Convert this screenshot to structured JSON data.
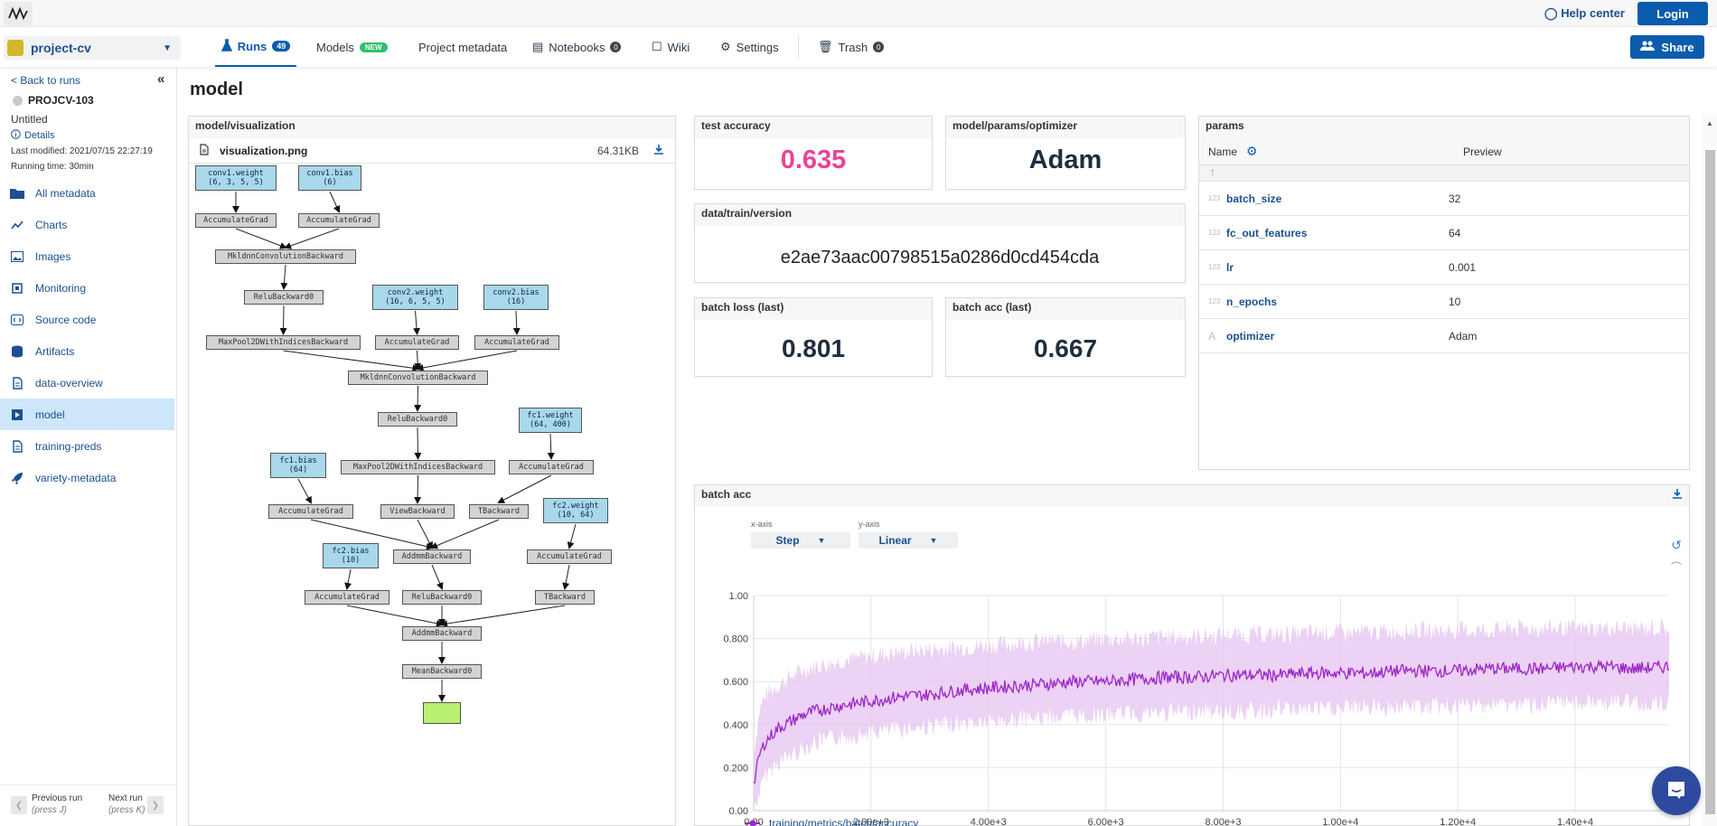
{
  "topbar": {
    "logo": "neptune-logo",
    "help_label": "Help center",
    "login_label": "Login"
  },
  "nav": {
    "project_name": "project-cv",
    "project_color": "#d4b62a",
    "tabs": [
      {
        "label": "Runs",
        "badge": "49",
        "active": true
      },
      {
        "label": "Models",
        "badge": "NEW"
      },
      {
        "label": "Project metadata"
      },
      {
        "label": "Notebooks",
        "badge": "0"
      },
      {
        "label": "Wiki"
      },
      {
        "label": "Settings"
      },
      {
        "label": "Trash",
        "badge": "0"
      }
    ],
    "share_label": "Share"
  },
  "sidebar": {
    "back_label": "< Back to runs",
    "collapse_label": "«",
    "run_id": "PROJCV-103",
    "run_name": "Untitled",
    "details_label": "Details",
    "last_modified": "Last modified: 2021/07/15 22:27:19",
    "running_time": "Running time: 30min",
    "items": [
      {
        "label": "All metadata",
        "icon": "folder-icon"
      },
      {
        "label": "Charts",
        "icon": "chart-icon"
      },
      {
        "label": "Images",
        "icon": "image-icon"
      },
      {
        "label": "Monitoring",
        "icon": "cpu-icon"
      },
      {
        "label": "Source code",
        "icon": "code-icon"
      },
      {
        "label": "Artifacts",
        "icon": "database-icon"
      },
      {
        "label": "data-overview",
        "icon": "document-icon"
      },
      {
        "label": "model",
        "icon": "play-icon",
        "active": true
      },
      {
        "label": "training-preds",
        "icon": "document-icon"
      },
      {
        "label": "variety-metadata",
        "icon": "rocket-icon"
      }
    ],
    "prev_label": "Previous run",
    "prev_hint": "(press J)",
    "next_label": "Next run",
    "next_hint": "(press K)"
  },
  "main": {
    "title": "model",
    "visualization": {
      "title": "model/visualization",
      "file_name": "visualization.png",
      "file_size": "64.31KB",
      "nodes": [
        {
          "id": "n1",
          "label": "conv1.weight\n(6, 3, 5, 5)",
          "kind": "param"
        },
        {
          "id": "n2",
          "label": "conv1.bias\n(6)",
          "kind": "param"
        },
        {
          "id": "n3",
          "label": "AccumulateGrad",
          "kind": "op"
        },
        {
          "id": "n4",
          "label": "AccumulateGrad",
          "kind": "op"
        },
        {
          "id": "n5",
          "label": "MkldnnConvolutionBackward",
          "kind": "op"
        },
        {
          "id": "n6",
          "label": "ReluBackward0",
          "kind": "op"
        },
        {
          "id": "n7",
          "label": "conv2.weight\n(16, 6, 5, 5)",
          "kind": "param"
        },
        {
          "id": "n8",
          "label": "conv2.bias\n(16)",
          "kind": "param"
        },
        {
          "id": "n9",
          "label": "MaxPool2DWithIndicesBackward",
          "kind": "op"
        },
        {
          "id": "n10",
          "label": "AccumulateGrad",
          "kind": "op"
        },
        {
          "id": "n11",
          "label": "AccumulateGrad",
          "kind": "op"
        },
        {
          "id": "n12",
          "label": "MkldnnConvolutionBackward",
          "kind": "op"
        },
        {
          "id": "n13",
          "label": "ReluBackward0",
          "kind": "op"
        },
        {
          "id": "n14",
          "label": "fc1.weight\n(64, 400)",
          "kind": "param"
        },
        {
          "id": "n15",
          "label": "fc1.bias\n(64)",
          "kind": "param"
        },
        {
          "id": "n16",
          "label": "MaxPool2DWithIndicesBackward",
          "kind": "op"
        },
        {
          "id": "n17",
          "label": "AccumulateGrad",
          "kind": "op"
        },
        {
          "id": "n18",
          "label": "AccumulateGrad",
          "kind": "op"
        },
        {
          "id": "n19",
          "label": "ViewBackward",
          "kind": "op"
        },
        {
          "id": "n20",
          "label": "TBackward",
          "kind": "op"
        },
        {
          "id": "n21",
          "label": "fc2.weight\n(10, 64)",
          "kind": "param"
        },
        {
          "id": "n22",
          "label": "fc2.bias\n(10)",
          "kind": "param"
        },
        {
          "id": "n23",
          "label": "AddmmBackward",
          "kind": "op"
        },
        {
          "id": "n24",
          "label": "AccumulateGrad",
          "kind": "op"
        },
        {
          "id": "n25",
          "label": "AccumulateGrad",
          "kind": "op"
        },
        {
          "id": "n26",
          "label": "ReluBackward0",
          "kind": "op"
        },
        {
          "id": "n27",
          "label": "TBackward",
          "kind": "op"
        },
        {
          "id": "n28",
          "label": "AddmmBackward",
          "kind": "op"
        },
        {
          "id": "n29",
          "label": "MeanBackward0",
          "kind": "op"
        },
        {
          "id": "n30",
          "label": "",
          "kind": "out"
        }
      ],
      "edges": [
        [
          "n1",
          "n3"
        ],
        [
          "n2",
          "n4"
        ],
        [
          "n3",
          "n5"
        ],
        [
          "n4",
          "n5"
        ],
        [
          "n5",
          "n6"
        ],
        [
          "n6",
          "n9"
        ],
        [
          "n7",
          "n10"
        ],
        [
          "n8",
          "n11"
        ],
        [
          "n9",
          "n12"
        ],
        [
          "n10",
          "n12"
        ],
        [
          "n11",
          "n12"
        ],
        [
          "n12",
          "n13"
        ],
        [
          "n13",
          "n16"
        ],
        [
          "n14",
          "n17"
        ],
        [
          "n15",
          "n18"
        ],
        [
          "n16",
          "n19"
        ],
        [
          "n17",
          "n20"
        ],
        [
          "n18",
          "n23"
        ],
        [
          "n19",
          "n23"
        ],
        [
          "n20",
          "n23"
        ],
        [
          "n21",
          "n25"
        ],
        [
          "n22",
          "n24"
        ],
        [
          "n23",
          "n26"
        ],
        [
          "n25",
          "n27"
        ],
        [
          "n24",
          "n28"
        ],
        [
          "n26",
          "n28"
        ],
        [
          "n27",
          "n28"
        ],
        [
          "n28",
          "n29"
        ],
        [
          "n29",
          "n30"
        ]
      ]
    },
    "tiles": {
      "test_accuracy": {
        "title": "test accuracy",
        "value": "0.635",
        "color": "#e8449a"
      },
      "optimizer": {
        "title": "model/params/optimizer",
        "value": "Adam"
      },
      "data_version": {
        "title": "data/train/version",
        "value": "e2ae73aac00798515a0286d0cd454cda"
      },
      "batch_loss": {
        "title": "batch loss (last)",
        "value": "0.801"
      },
      "batch_acc": {
        "title": "batch acc (last)",
        "value": "0.667"
      }
    },
    "params": {
      "title": "params",
      "col_name": "Name",
      "col_preview": "Preview",
      "up_label": "↑",
      "rows": [
        {
          "type": "123",
          "name": "batch_size",
          "value": "32"
        },
        {
          "type": "123",
          "name": "fc_out_features",
          "value": "64"
        },
        {
          "type": "123",
          "name": "lr",
          "value": "0.001"
        },
        {
          "type": "123",
          "name": "n_epochs",
          "value": "10"
        },
        {
          "type": "A",
          "name": "optimizer",
          "value": "Adam"
        }
      ]
    },
    "chart_panel": {
      "title": "batch acc",
      "xaxis_label": "x-axis",
      "xaxis_value": "Step",
      "yaxis_label": "y-axis",
      "yaxis_value": "Linear"
    }
  },
  "chart_data": {
    "type": "line",
    "title": "batch acc",
    "xlabel": "Step",
    "ylabel": "",
    "xlim": [
      0,
      15600
    ],
    "ylim": [
      0,
      1.0
    ],
    "x_ticks": [
      "0.00",
      "2.00e+3",
      "4.00e+3",
      "6.00e+3",
      "8.00e+3",
      "1.00e+4",
      "1.20e+4",
      "1.40e+4"
    ],
    "x_tick_values": [
      0,
      2000,
      4000,
      6000,
      8000,
      10000,
      12000,
      14000
    ],
    "y_ticks": [
      "0.00",
      "0.200",
      "0.400",
      "0.600",
      "0.800",
      "1.00"
    ],
    "y_tick_values": [
      0,
      0.2,
      0.4,
      0.6,
      0.8,
      1.0
    ],
    "grid": true,
    "legend": "bottom-left",
    "series": [
      {
        "name": "training/metrics/batch/accuracy",
        "color": "#9b27c8",
        "band_color": "#e6c3f0",
        "x": [
          0,
          100,
          200,
          400,
          600,
          800,
          1000,
          1500,
          2000,
          2500,
          3000,
          3500,
          4000,
          4500,
          5000,
          5500,
          6000,
          6500,
          7000,
          7500,
          8000,
          8500,
          9000,
          9500,
          10000,
          10500,
          11000,
          11500,
          12000,
          12500,
          13000,
          13500,
          14000,
          14500,
          15000,
          15600
        ],
        "values": [
          0.12,
          0.26,
          0.32,
          0.38,
          0.41,
          0.44,
          0.46,
          0.49,
          0.51,
          0.53,
          0.54,
          0.56,
          0.57,
          0.58,
          0.59,
          0.6,
          0.6,
          0.61,
          0.62,
          0.62,
          0.63,
          0.63,
          0.63,
          0.64,
          0.64,
          0.64,
          0.65,
          0.65,
          0.65,
          0.66,
          0.66,
          0.66,
          0.67,
          0.67,
          0.66,
          0.67
        ],
        "band_low": [
          0.02,
          0.1,
          0.18,
          0.24,
          0.27,
          0.3,
          0.33,
          0.36,
          0.38,
          0.4,
          0.41,
          0.42,
          0.43,
          0.44,
          0.45,
          0.46,
          0.46,
          0.47,
          0.47,
          0.48,
          0.48,
          0.48,
          0.49,
          0.49,
          0.49,
          0.5,
          0.5,
          0.5,
          0.5,
          0.51,
          0.51,
          0.51,
          0.52,
          0.52,
          0.52,
          0.52
        ],
        "band_high": [
          0.25,
          0.45,
          0.52,
          0.56,
          0.6,
          0.63,
          0.65,
          0.68,
          0.7,
          0.72,
          0.73,
          0.74,
          0.75,
          0.76,
          0.77,
          0.77,
          0.78,
          0.78,
          0.79,
          0.79,
          0.8,
          0.8,
          0.8,
          0.81,
          0.81,
          0.81,
          0.82,
          0.82,
          0.82,
          0.82,
          0.83,
          0.83,
          0.83,
          0.83,
          0.83,
          0.83
        ]
      }
    ]
  }
}
